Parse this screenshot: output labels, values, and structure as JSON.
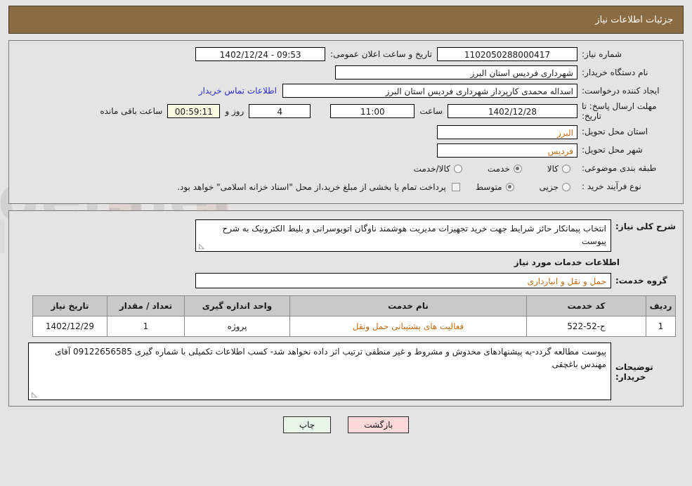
{
  "header": {
    "title": "جزئیات اطلاعات نیاز"
  },
  "form": {
    "need_number_label": "شماره نیاز:",
    "need_number_value": "1102050288000417",
    "public_announce_label": "تاریخ و ساعت اعلان عمومی:",
    "public_announce_value": "09:53 - 1402/12/24",
    "buyer_org_label": "نام دستگاه خریدار:",
    "buyer_org_value": "شهرداری فردیس استان البرز",
    "creator_label": "ایجاد کننده درخواست:",
    "creator_value": "اسداله محمدی کارپرداز شهرداری فردیس استان البرز",
    "contact_link": "اطلاعات تماس خریدار",
    "deadline_label": "مهلت ارسال پاسخ: تا تاریخ:",
    "deadline_value": "1402/12/28",
    "hour_label": "ساعت",
    "hour_value": "11:00",
    "days_value": "4",
    "days_label": "روز و",
    "timer_value": "00:59:11",
    "timer_label": "ساعت باقی مانده",
    "province_label": "استان محل تحویل:",
    "province_value": "البرز",
    "city_label": "شهر محل تحویل:",
    "city_value": "فردیس",
    "category_label": "طبقه بندی موضوعی:",
    "category_options": [
      {
        "label": "کالا",
        "selected": false
      },
      {
        "label": "خدمت",
        "selected": true
      },
      {
        "label": "کالا/خدمت",
        "selected": false
      }
    ],
    "process_label": "نوع فرآیند خرید :",
    "process_options": [
      {
        "label": "جزیی",
        "selected": false
      },
      {
        "label": "متوسط",
        "selected": true
      }
    ],
    "treasury_checkbox_label": "پرداخت تمام یا بخشی از مبلغ خرید،از محل \"اسناد خزانه اسلامی\" خواهد بود.",
    "treasury_checked": false
  },
  "details": {
    "general_desc_label": "شرح کلی نیاز:",
    "general_desc_value": "انتخاب پیمانکار حائز شرایط جهت خرید تجهیزات مدیریت هوشمند ناوگان اتوبوسرانی و بلیط الکترونیک به شرح پیوست",
    "services_section_title": "اطلاعات خدمات مورد نیاز",
    "service_group_label": "گروه خدمت:",
    "service_group_value": "حمل و نقل و انبارداری",
    "resizer_glyph": "◺"
  },
  "table": {
    "headers": [
      "ردیف",
      "کد خدمت",
      "نام خدمت",
      "واحد اندازه گیری",
      "تعداد / مقدار",
      "تاریخ نیاز"
    ],
    "rows": [
      {
        "row_no": "1",
        "service_code": "ح-52-522",
        "service_name": "فعالیت های پشتیبانی حمل ونقل",
        "unit": "پروژه",
        "quantity": "1",
        "need_date": "1402/12/29"
      }
    ]
  },
  "buyer_notes": {
    "label": "توضیحات خریدار:",
    "value": "پیوست مطالعه گردد-به پیشنهادهای مخدوش و مشروط و غیر منطقی ترتیب اثر داده نخواهد شد- کسب اطلاعات تکمیلی با شماره گیری 09122656585 آقای مهندس باغچقی"
  },
  "buttons": {
    "print": "چاپ",
    "back": "بازگشت"
  },
  "watermark": {
    "text": "AriaTender.net"
  },
  "colors": {
    "header_bg": "#8b6b42",
    "accent_orange": "#c96a12",
    "link_blue": "#2a2ad0",
    "print_btn": "#e8f6e8",
    "back_btn": "#fbd9d9",
    "timer_bg": "#fbfbe2"
  }
}
